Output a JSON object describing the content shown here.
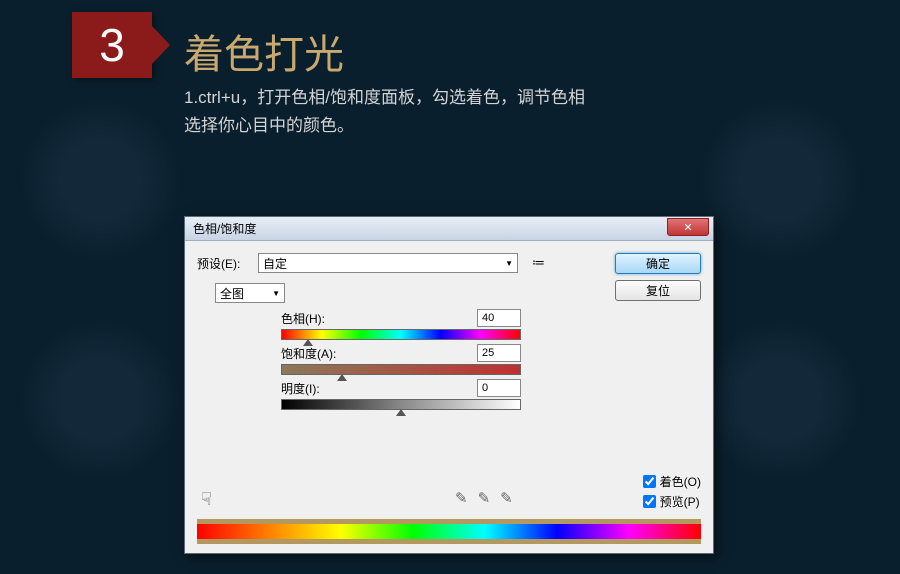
{
  "step": {
    "number": "3",
    "title": "着色打光"
  },
  "description": {
    "line1": "1.ctrl+u，打开色相/饱和度面板，勾选着色，调节色相",
    "line2": "选择你心目中的颜色。"
  },
  "dialog": {
    "title": "色相/饱和度",
    "close": "✕",
    "preset_label": "预设(E):",
    "preset_value": "自定",
    "ok": "确定",
    "reset": "复位",
    "master": "全图",
    "sliders": {
      "hue": {
        "label": "色相(H):",
        "value": "40",
        "position_pct": 11
      },
      "sat": {
        "label": "饱和度(A):",
        "value": "25",
        "position_pct": 25
      },
      "light": {
        "label": "明度(I):",
        "value": "0",
        "position_pct": 50
      }
    },
    "colorize": "着色(O)",
    "preview": "预览(P)"
  }
}
